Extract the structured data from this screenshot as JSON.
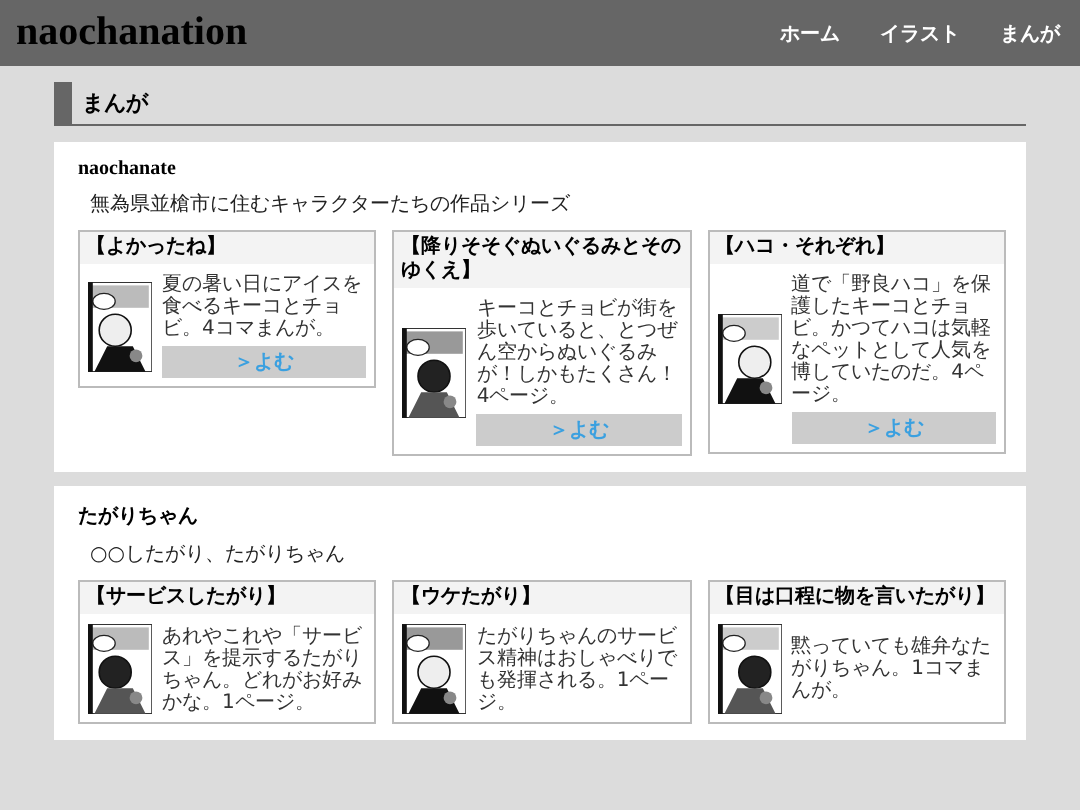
{
  "site": {
    "title": "naochanation",
    "nav": [
      {
        "label": "ホーム"
      },
      {
        "label": "イラスト"
      },
      {
        "label": "まんが"
      }
    ]
  },
  "page_heading": "まんが",
  "series": [
    {
      "title": "naochanate",
      "kind": "serif",
      "description": "無為県並槍市に住むキャラクターたちの作品シリーズ",
      "works": [
        {
          "title": "【よかったね】",
          "summary": "夏の暑い日にアイスを食べるキーコとチョビ。4コマまんが。",
          "button": "＞よむ"
        },
        {
          "title": "【降りそそぐぬいぐるみとそのゆくえ】",
          "summary": "キーコとチョビが街を歩いていると、とつぜん空からぬいぐるみが！しかもたくさん！4ページ。",
          "button": "＞よむ"
        },
        {
          "title": "【ハコ・それぞれ】",
          "summary": "道で「野良ハコ」を保護したキーコとチョビ。かつてハコは気軽なペットとして人気を博していたのだ。4ページ。",
          "button": "＞よむ"
        }
      ]
    },
    {
      "title": "たがりちゃん",
      "kind": "sans",
      "description": "○○したがり、たがりちゃん",
      "works": [
        {
          "title": "【サービスしたがり】",
          "summary": "あれやこれや「サービス」を提示するたがりちゃん。どれがお好みかな。1ページ。"
        },
        {
          "title": "【ウケたがり】",
          "summary": "たがりちゃんのサービス精神はおしゃべりでも発揮される。1ページ。"
        },
        {
          "title": "【目は口程に物を言いたがり】",
          "summary": "黙っていても雄弁なたがりちゃん。1コマまんが。"
        }
      ]
    }
  ]
}
